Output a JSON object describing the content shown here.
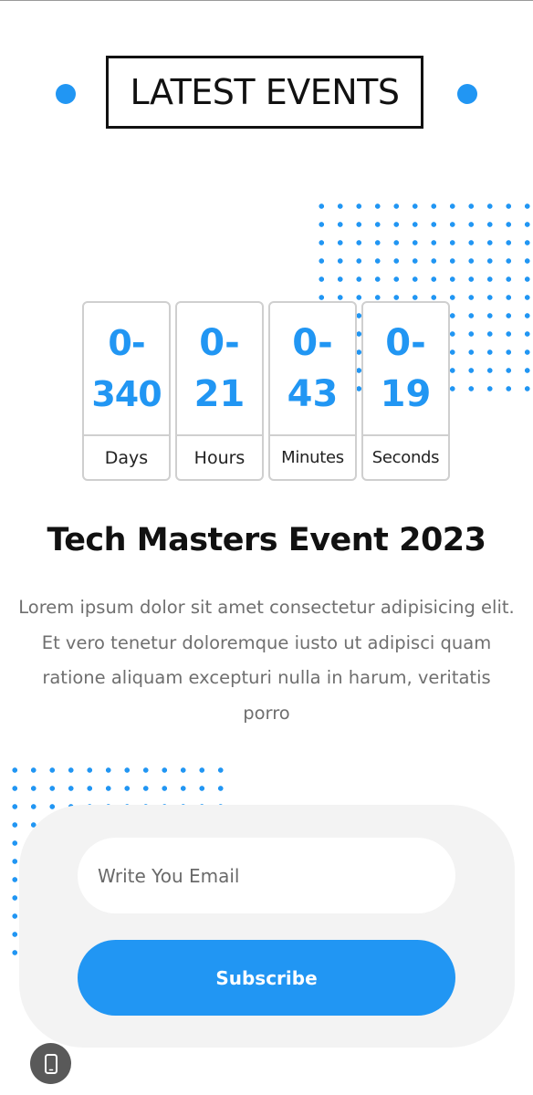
{
  "section": {
    "title": "LATEST EVENTS"
  },
  "countdown": [
    {
      "value_line1": "0-",
      "value_line2": "340",
      "label": "Days"
    },
    {
      "value_line1": "0-",
      "value_line2": "21",
      "label": "Hours"
    },
    {
      "value_line1": "0-",
      "value_line2": "43",
      "label": "Minutes"
    },
    {
      "value_line1": "0-",
      "value_line2": "19",
      "label": "Seconds"
    }
  ],
  "event": {
    "title": "Tech Masters Event 2023",
    "description": "Lorem ipsum dolor sit amet consectetur adipisicing elit. Et vero tenetur doloremque iusto ut adipisci quam ratione aliquam excepturi nulla in harum, veritatis porro"
  },
  "subscribe": {
    "email_placeholder": "Write You Email",
    "email_value": "",
    "button_label": "Subscribe"
  },
  "icons": {
    "device_button": "mobile-device-icon"
  },
  "colors": {
    "accent": "#2196f3",
    "card_background": "#f3f3f3",
    "title_text": "#111111",
    "body_text": "#6f6f6f"
  }
}
